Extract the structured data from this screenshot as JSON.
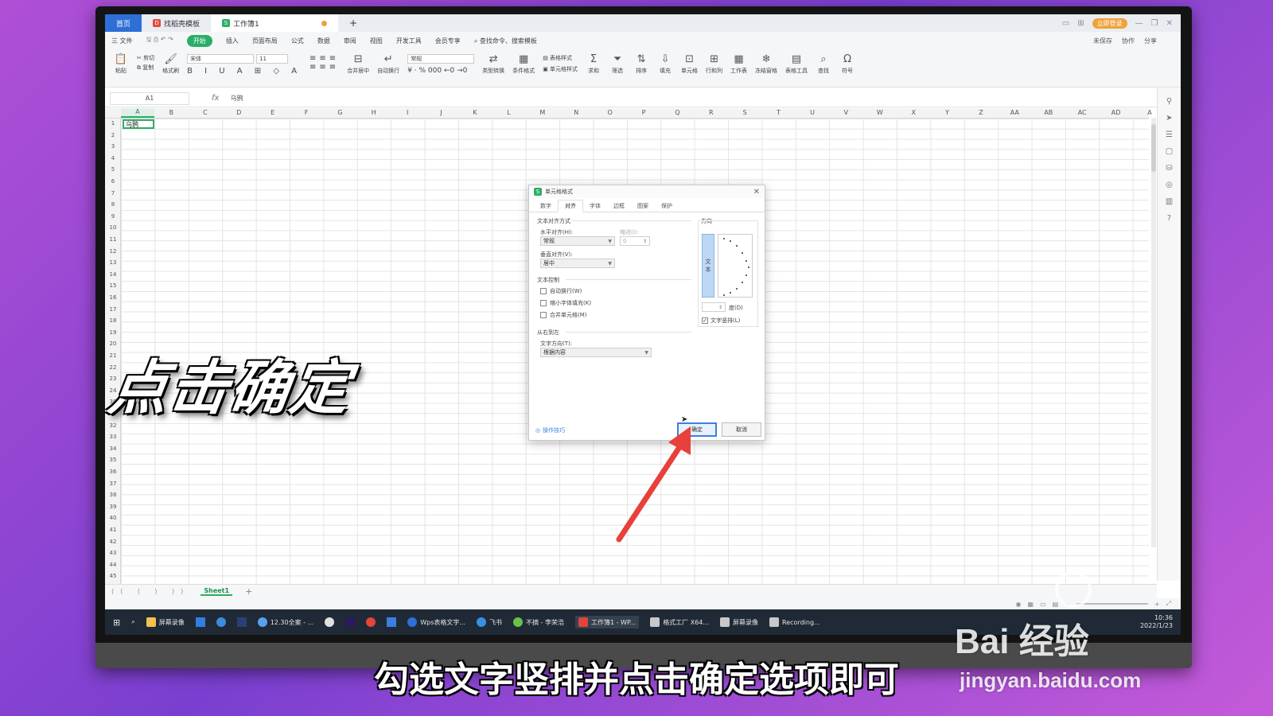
{
  "tabs": {
    "home": "首页",
    "template": "找稻壳模板",
    "workbook": "工作簿1",
    "add": "+"
  },
  "topright": {
    "login": "立即登录"
  },
  "menu": {
    "file": "三 文件",
    "items": [
      "开始",
      "插入",
      "页面布局",
      "公式",
      "数据",
      "审阅",
      "视图",
      "开发工具",
      "会员专享"
    ],
    "search": "查找命令、搜索模板",
    "unsaved": "未保存",
    "collab": "协作",
    "share": "分享"
  },
  "ribbon": {
    "paste": "粘贴",
    "cut": "剪切",
    "copy": "复制",
    "format_painter": "格式刷",
    "font_name": "宋体",
    "font_size": "11",
    "merge": "合并居中",
    "wrap": "自动换行",
    "number_format": "常规",
    "type_convert": "类型转换",
    "cond_format": "条件格式",
    "table_style": "表格样式",
    "cell_style": "单元格样式",
    "sum": "求和",
    "filter": "筛选",
    "sort": "排序",
    "fill": "填充",
    "cell": "单元格",
    "rowcol": "行和列",
    "sheet": "工作表",
    "freeze": "冻结窗格",
    "tabletools": "表格工具",
    "find": "查找",
    "symbol": "符号"
  },
  "formula": {
    "cell_ref": "A1",
    "fx": "fx",
    "value": "乌鸦"
  },
  "columns": [
    "A",
    "B",
    "C",
    "D",
    "E",
    "F",
    "G",
    "H",
    "I",
    "J",
    "K",
    "L",
    "M",
    "N",
    "O",
    "P",
    "Q",
    "R",
    "S",
    "T",
    "U",
    "V",
    "W",
    "X",
    "Y",
    "Z",
    "AA",
    "AB",
    "AC",
    "AD",
    "A"
  ],
  "rows": [
    "1",
    "2",
    "3",
    "4",
    "5",
    "6",
    "7",
    "8",
    "9",
    "10",
    "11",
    "12",
    "13",
    "14",
    "15",
    "16",
    "17",
    "18",
    "19",
    "20",
    "21",
    "22",
    "23",
    "24",
    "30",
    "31",
    "32",
    "33",
    "34",
    "35",
    "36",
    "37",
    "38",
    "39",
    "40",
    "41",
    "42",
    "43",
    "44",
    "45"
  ],
  "cell_a1": "乌鸦",
  "sheet": {
    "name": "Sheet1",
    "add": "+"
  },
  "dialog": {
    "title": "单元格格式",
    "tabs": [
      "数字",
      "对齐",
      "字体",
      "边框",
      "图案",
      "保护"
    ],
    "active_tab": "对齐",
    "text_align_section": "文本对齐方式",
    "horizontal_label": "水平对齐(H):",
    "horizontal_value": "常规",
    "indent_label": "缩进(I):",
    "indent_value": "0",
    "vertical_label": "垂直对齐(V):",
    "vertical_value": "居中",
    "text_control_section": "文本控制",
    "wrap_label": "自动换行(W)",
    "shrink_label": "缩小字体填充(K)",
    "merge_label": "合并单元格(M)",
    "rtl_section": "从右到左",
    "direction_label": "文字方向(T):",
    "direction_value": "根据内容",
    "orientation_section": "方向",
    "orientation_text_char1": "文",
    "orientation_text_char2": "本",
    "degree_label": "度(D)",
    "vertical_text_label": "文字竖排(L)",
    "vertical_text_checked": true,
    "tips": "操作技巧",
    "ok": "确定",
    "cancel": "取消"
  },
  "taskbar": {
    "items": [
      "屏幕录像",
      "12.30全案 - ...",
      "Wps表格文字...",
      "飞书",
      "不摘 - 李荣浩",
      "工作簿1 - WP...",
      "格式工厂 X64...",
      "屏幕录像",
      "Recording..."
    ],
    "time": "10:36",
    "date": "2022/1/23"
  },
  "overlay": {
    "title": "点击确定",
    "subtitle": "勾选文字竖排并点击确定选项即可"
  },
  "watermark": {
    "main": "Bai 经验",
    "url": "jingyan.baidu.com"
  },
  "colors": {
    "accent": "#2aae67",
    "arrow": "#e8403a",
    "dialog_ok": "#3b7fe0"
  }
}
